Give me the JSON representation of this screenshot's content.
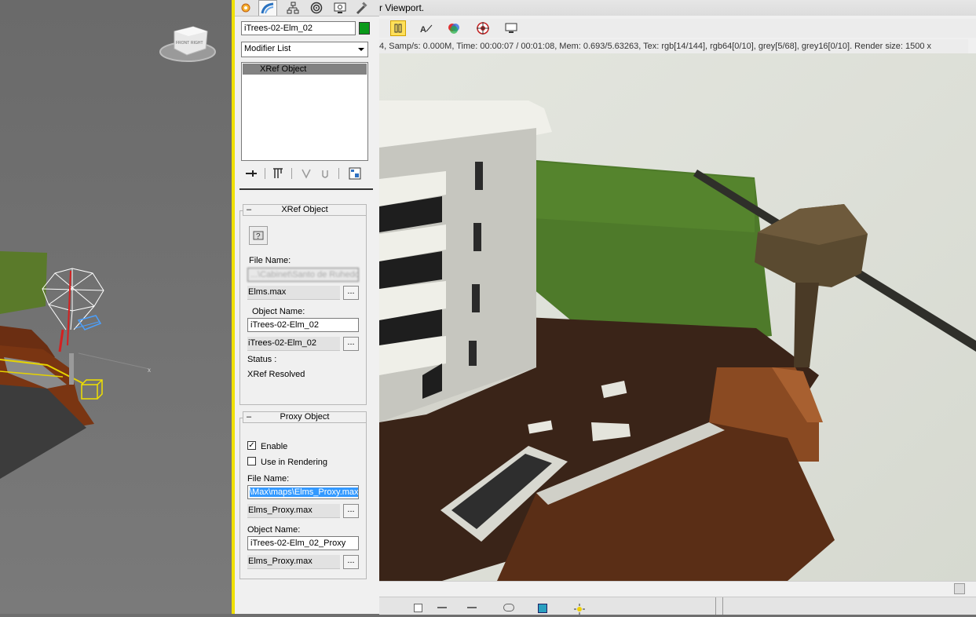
{
  "viewport": {
    "viewcube_labels": [
      "FRONT",
      "RIGHT"
    ],
    "axis_label": "x"
  },
  "command_panel": {
    "tabs": [
      {
        "icon": "create-icon",
        "label": "Create"
      },
      {
        "icon": "modify-icon",
        "label": "Modify"
      },
      {
        "icon": "hierarchy-icon",
        "label": "Hierarchy"
      },
      {
        "icon": "motion-icon",
        "label": "Motion"
      },
      {
        "icon": "display-icon",
        "label": "Display"
      },
      {
        "icon": "utilities-icon",
        "label": "Utilities"
      }
    ],
    "object_name": "iTrees-02-Elm_02",
    "object_color": "#0a9a1a",
    "modifier_list": "Modifier List",
    "stack_items": [
      "XRef Object"
    ],
    "xref_rollout": {
      "title": "XRef Object",
      "file_name_label": "File Name:",
      "file_path_value": "...\\Cabinet\\Santo de Ruhedo",
      "file_name_value": "Elms.max",
      "object_name_label": "Object Name:",
      "object_name_input": "iTrees-02-Elm_02",
      "object_name_value": "iTrees-02-Elm_02",
      "status_label": "Status :",
      "status_value": "XRef Resolved",
      "browse": "..."
    },
    "proxy_rollout": {
      "title": "Proxy Object",
      "enable_label": "Enable",
      "enable_checked": true,
      "use_in_rendering_label": "Use in Rendering",
      "use_in_rendering_checked": false,
      "file_name_label": "File Name:",
      "file_path_value": "\\Max\\maps\\Elms_Proxy.max",
      "file_name_value": "Elms_Proxy.max",
      "object_name_label": "Object Name:",
      "object_name_input": "iTrees-02-Elm_02_Proxy",
      "object_name_value": "Elms_Proxy.max",
      "browse": "..."
    }
  },
  "render_window": {
    "title": "r Viewport.",
    "status": "4,  Samp/s: 0.000M,  Time: 00:00:07 / 00:01:08,  Mem: 0.693/5.63263,  Tex: rgb[14/144], rgb64[0/10], grey[5/68], grey16[0/10].  Render size: 1500 x"
  },
  "colors": {
    "panel_accent": "#f0e000",
    "selection": "#3399ff",
    "active_button": "#ffe05a"
  }
}
